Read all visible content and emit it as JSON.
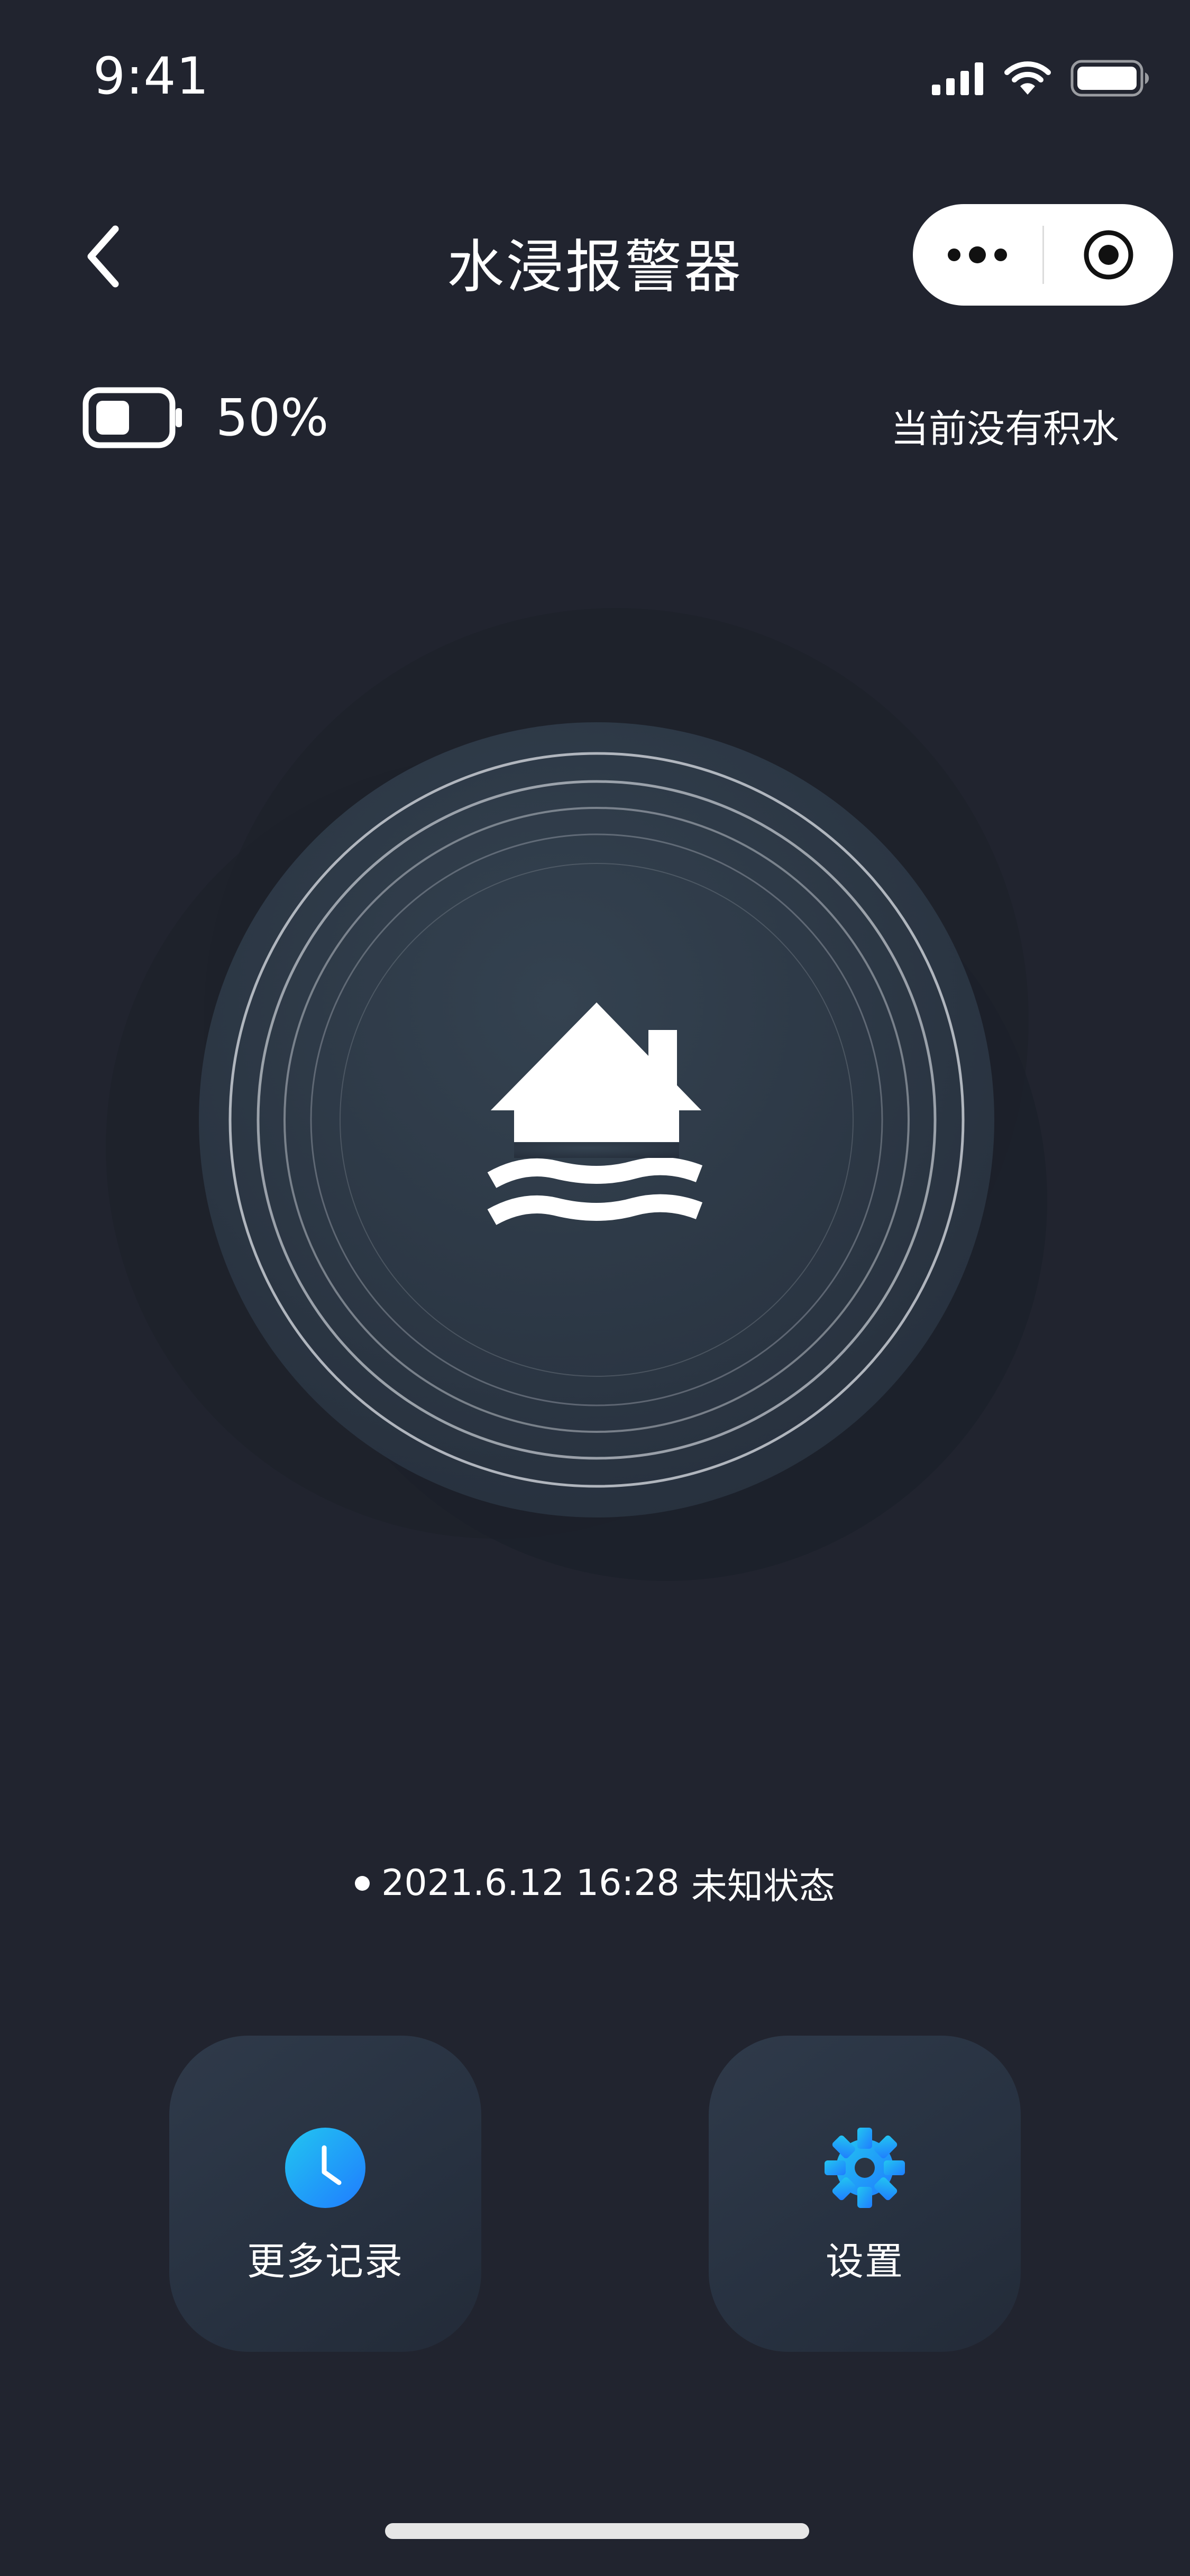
{
  "status_bar": {
    "time": "9:41",
    "icons": [
      "signal-icon",
      "wifi-icon",
      "battery-icon"
    ]
  },
  "nav": {
    "title": "水浸报警器",
    "back_icon": "chevron-left-icon",
    "capsule": {
      "more_icon": "more-dots-icon",
      "close_icon": "target-icon"
    }
  },
  "device": {
    "battery_level": 0.5,
    "battery_text": "50%",
    "water_status": "当前没有积水"
  },
  "hero": {
    "icon": "house-flood-icon"
  },
  "record": {
    "datetime": "2021.6.12 16:28",
    "state": "未知状态"
  },
  "actions": [
    {
      "label": "更多记录",
      "icon": "clock-icon"
    },
    {
      "label": "设置",
      "icon": "gear-icon"
    }
  ],
  "colors": {
    "background": "#21242f",
    "accent_blue": "#1f8fff",
    "accent_cyan": "#22c6f0"
  }
}
